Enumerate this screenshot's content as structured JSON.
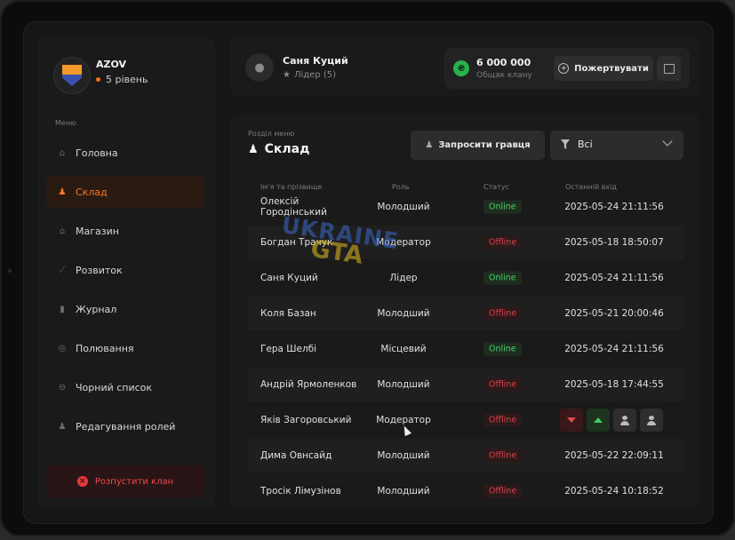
{
  "clan": {
    "name": "AZOV",
    "level": "5 рівень"
  },
  "menu": {
    "caption": "Меню",
    "items": [
      {
        "label": "Головна",
        "icon": "home-icon",
        "glyph": "⌂"
      },
      {
        "label": "Склад",
        "icon": "group-icon",
        "glyph": "♟"
      },
      {
        "label": "Магазин",
        "icon": "basket-icon",
        "glyph": "⌂"
      },
      {
        "label": "Розвиток",
        "icon": "chart-icon",
        "glyph": "⟋"
      },
      {
        "label": "Журнал",
        "icon": "book-icon",
        "glyph": "▮"
      },
      {
        "label": "Полювання",
        "icon": "target-icon",
        "glyph": "◎"
      },
      {
        "label": "Чорний список",
        "icon": "block-icon",
        "glyph": "⊖"
      },
      {
        "label": "Редагування ролей",
        "icon": "user-edit-icon",
        "glyph": "♟"
      }
    ],
    "active_index": 1,
    "disband_label": "Розпустити клан"
  },
  "user": {
    "name": "Саня Куций",
    "role": "Лідер (5)"
  },
  "fund": {
    "amount": "6 000 000",
    "label": "Общак клану",
    "donate_label": "Пожертвувати",
    "currency_glyph": "₴"
  },
  "section": {
    "caption": "Розділ меню",
    "title": "Склад",
    "invite_label": "Запросити гравця",
    "filter_value": "Всі"
  },
  "table": {
    "headers": [
      "Ім'я та прізвище",
      "Роль",
      "Статус",
      "Останній вхід"
    ],
    "rows": [
      {
        "name": "Олексій Городінський",
        "role": "Молодший",
        "status": "Online",
        "last": "2025-05-24 21:11:56"
      },
      {
        "name": "Богдан Трачук",
        "role": "Модератор",
        "status": "Offline",
        "last": "2025-05-18 18:50:07"
      },
      {
        "name": "Саня Куций",
        "role": "Лідер",
        "status": "Online",
        "last": "2025-05-24 21:11:56"
      },
      {
        "name": "Коля Базан",
        "role": "Молодший",
        "status": "Offline",
        "last": "2025-05-21 20:00:46"
      },
      {
        "name": "Гера Шелбі",
        "role": "Місцевий",
        "status": "Online",
        "last": "2025-05-24 21:11:56"
      },
      {
        "name": "Андрій Ярмоленков",
        "role": "Молодший",
        "status": "Offline",
        "last": "2025-05-18 17:44:55"
      },
      {
        "name": "Яків Загоровський",
        "role": "Модератор",
        "status": "Offline",
        "last": "",
        "hovered": true
      },
      {
        "name": "Дима Овнсайд",
        "role": "Молодший",
        "status": "Offline",
        "last": "2025-05-22 22:09:11"
      },
      {
        "name": "Тросік Лімузінов",
        "role": "Молодший",
        "status": "Offline",
        "last": "2025-05-24 10:18:52"
      }
    ]
  },
  "watermark": {
    "line1": "UKRAINE",
    "line2": "GTA"
  },
  "colors": {
    "accent": "#ff7a22",
    "online": "#48d06a",
    "offline": "#d8424a",
    "danger": "#e63a3a"
  }
}
